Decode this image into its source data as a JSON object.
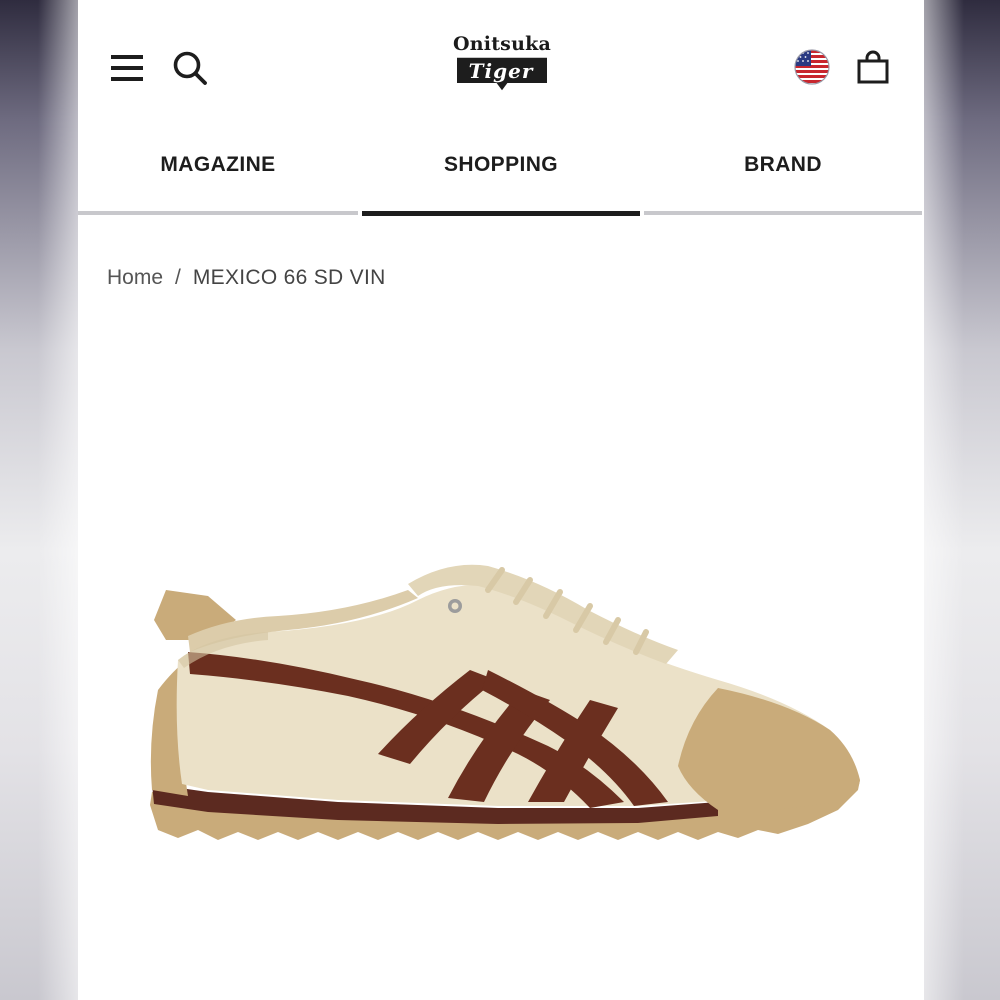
{
  "header": {
    "logo": {
      "line1": "Onitsuka",
      "line2": "Tiger"
    },
    "icons": [
      "hamburger-menu-icon",
      "search-icon",
      "us-flag-icon",
      "shopping-bag-icon"
    ]
  },
  "tabs": [
    {
      "label": "MAGAZINE",
      "active": false
    },
    {
      "label": "SHOPPING",
      "active": true
    },
    {
      "label": "BRAND",
      "active": false
    }
  ],
  "breadcrumb": {
    "home": "Home",
    "separator": "/",
    "current": "MEXICO 66 SD VIN"
  },
  "product": {
    "image": "cream-and-brown-leather-sneaker"
  },
  "colors": {
    "text": "#1d1d1d",
    "tab_inactive": "#c8c8cc",
    "tab_active": "#1d1d1d",
    "shoe_cream": "#ebe1c8",
    "shoe_brown": "#6b2f1f",
    "shoe_tan": "#c9ab7a"
  }
}
